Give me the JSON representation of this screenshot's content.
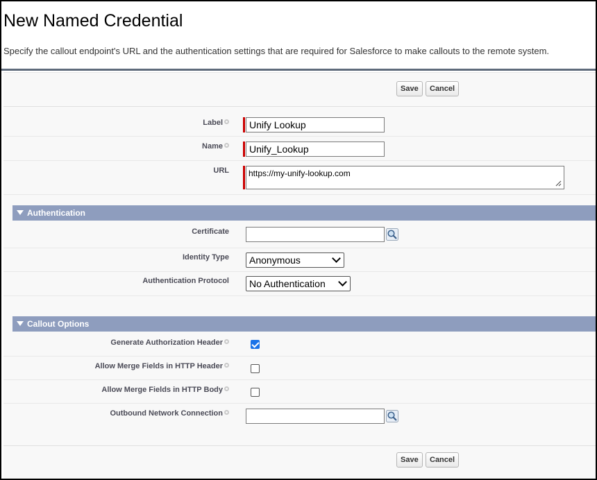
{
  "page": {
    "title": "New Named Credential",
    "subtitle": "Specify the callout endpoint's URL and the authentication settings that are required for Salesforce to make callouts to the remote system."
  },
  "buttons": {
    "save": "Save",
    "cancel": "Cancel"
  },
  "fields": {
    "label": {
      "label": "Label",
      "value": "Unify Lookup"
    },
    "name": {
      "label": "Name",
      "value": "Unify_Lookup"
    },
    "url": {
      "label": "URL",
      "value": "https://my-unify-lookup.com"
    }
  },
  "authentication": {
    "title": "Authentication",
    "certificate": {
      "label": "Certificate",
      "value": ""
    },
    "identity_type": {
      "label": "Identity Type",
      "value": "Anonymous"
    },
    "auth_protocol": {
      "label": "Authentication Protocol",
      "value": "No Authentication"
    }
  },
  "callout_options": {
    "title": "Callout Options",
    "gen_auth_header": {
      "label": "Generate Authorization Header",
      "checked": true
    },
    "merge_header": {
      "label": "Allow Merge Fields in HTTP Header",
      "checked": false
    },
    "merge_body": {
      "label": "Allow Merge Fields in HTTP Body",
      "checked": false
    },
    "outbound": {
      "label": "Outbound Network Connection",
      "value": ""
    }
  },
  "colors": {
    "section_header": "#8e9dbe",
    "required_bar": "#cc0000",
    "checkbox_checked": "#1a73e8"
  },
  "icons": {
    "lookup": "lookup-magnifier-icon",
    "help": "help-icon",
    "collapse": "triangle-down-icon"
  }
}
